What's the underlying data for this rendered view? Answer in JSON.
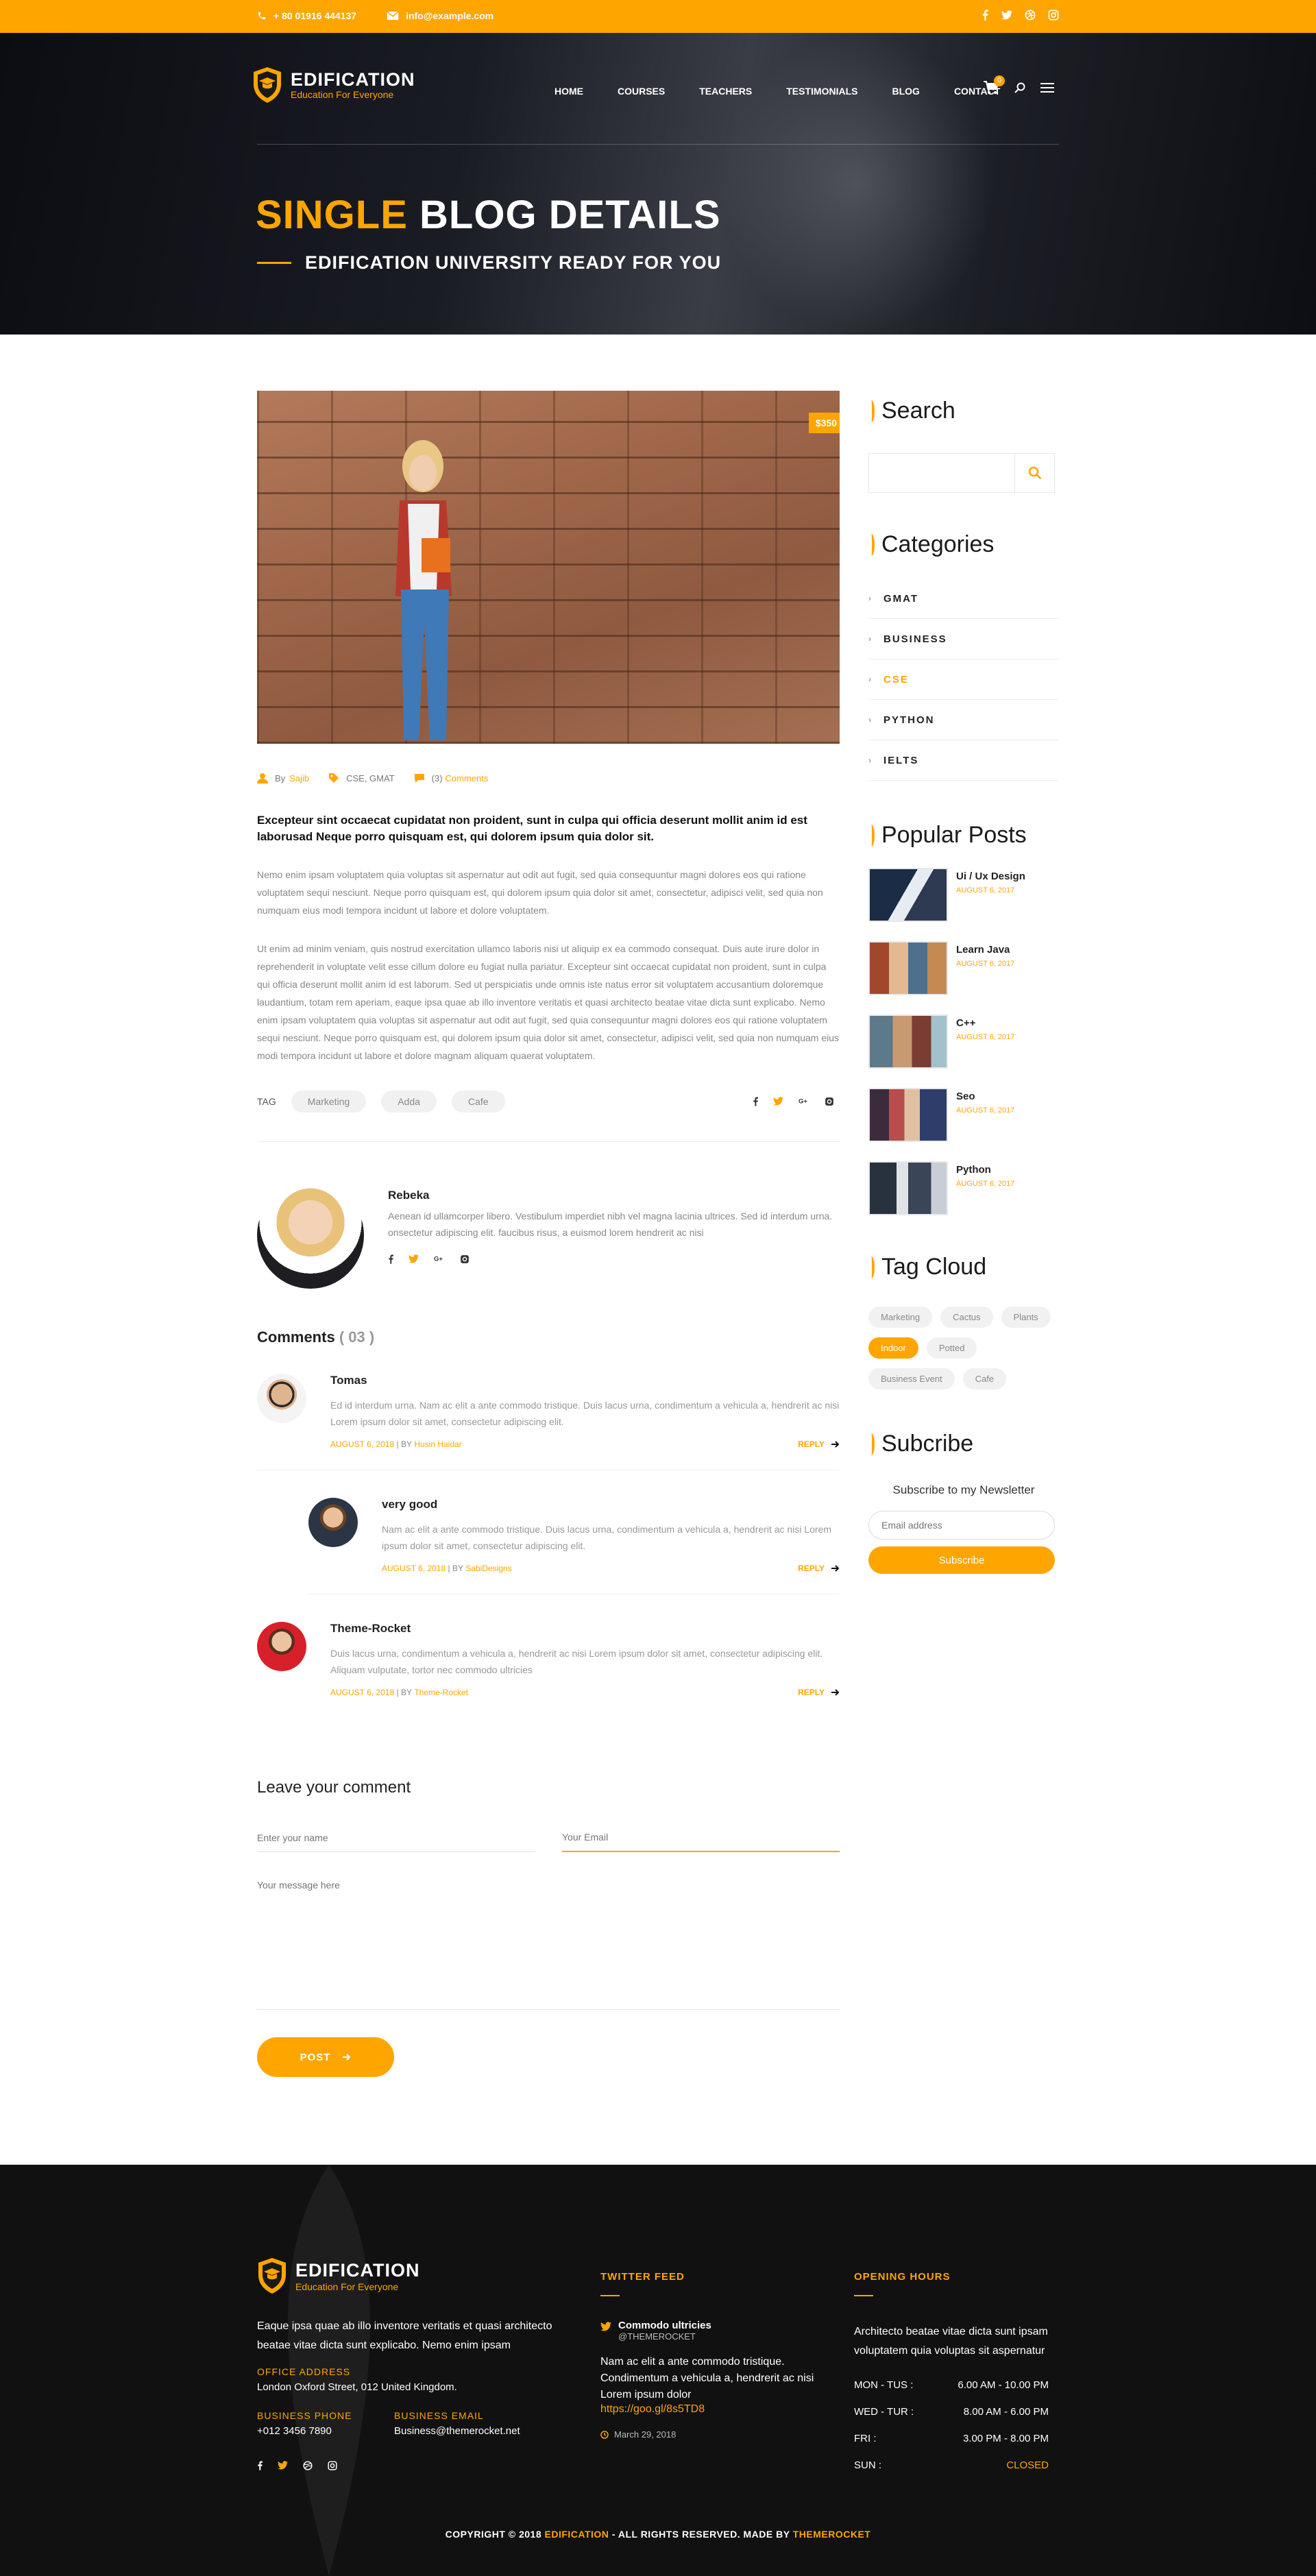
{
  "topbar": {
    "phone": "+ 80 01916 444137",
    "email": "info@example.com",
    "social": [
      "facebook-icon",
      "twitter-icon",
      "dribbble-icon",
      "instagram-icon"
    ]
  },
  "brand": {
    "name": "EDIFICATION",
    "tagline": "Education For Everyone"
  },
  "nav": {
    "items": [
      "HOME",
      "COURSES",
      "TEACHERS",
      "TESTIMONIALS",
      "BLOG",
      "CONTACT"
    ],
    "cart_count": "0"
  },
  "hero": {
    "title_highlight": "SINGLE",
    "title_rest": "BLOG DETAILS",
    "subtitle": "EDIFICATION UNIVERSITY READY FOR YOU"
  },
  "post": {
    "price": "$350",
    "author_prefix": "By",
    "author": "Sajib",
    "tags": "CSE, GMAT",
    "comment_count": "(3)",
    "comment_word": "Comments",
    "lead": "Excepteur sint occaecat cupidatat non proident, sunt in culpa qui officia deserunt mollit anim id est laborusad Neque porro quisquam est, qui dolorem ipsum quia dolor sit.",
    "para1": "Nemo enim ipsam voluptatem quia voluptas sit aspernatur aut odit aut fugit, sed quia consequuntur magni dolores eos qui ratione voluptatem sequi nesciunt. Neque porro quisquam est, qui dolorem ipsum quia dolor sit amet, consectetur, adipisci velit, sed quia non numquam eius modi tempora incidunt ut labore et dolore voluptatem.",
    "para2": "Ut enim ad minim veniam, quis nostrud exercitation ullamco laboris nisi ut aliquip ex ea commodo consequat. Duis aute irure dolor in reprehenderit in voluptate velit esse cillum dolore eu fugiat nulla pariatur. Excepteur sint occaecat cupidatat non proident, sunt in culpa qui officia deserunt mollit anim id est laborum. Sed ut perspiciatis unde omnis iste natus error sit voluptatem accusantium doloremque laudantium, totam rem aperiam, eaque ipsa quae ab illo inventore veritatis et quasi architecto beatae vitae dicta sunt explicabo. Nemo enim ipsam voluptatem quia voluptas sit aspernatur aut odit aut fugit, sed quia consequuntur magni dolores eos qui ratione voluptatem sequi nesciunt. Neque porro quisquam est, qui dolorem ipsum quia dolor sit amet, consectetur, adipisci velit, sed quia non numquam eius modi tempora incidunt ut labore et dolore magnam aliquam quaerat voluptatem.",
    "tag_label": "TAG",
    "tag_pills": [
      "Marketing",
      "Adda",
      "Cafe"
    ]
  },
  "author_box": {
    "name": "Rebeka",
    "bio": "Aenean id ullamcorper libero. Vestibulum imperdiet nibh vel magna lacinia ultrices. Sed id interdum urna. onsectetur adipiscing elit. faucibus risus, a euismod lorem hendrerit ac nisi"
  },
  "comments": {
    "heading": "Comments",
    "count": "( 03 )",
    "items": [
      {
        "name": "Tomas",
        "text": "Ed id interdum urna. Nam ac elit a ante commodo tristique. Duis lacus urna, condimentum a vehicula a, hendrerit ac nisi Lorem ipsum dolor sit amet, consectetur adipiscing elit.",
        "date": "AUGUST 6, 2018",
        "by": "BY",
        "author": "Husin Haidar",
        "reply": "REPLY"
      },
      {
        "name": "very good",
        "text": "Nam ac elit a ante commodo tristique. Duis lacus urna, condimentum a vehicula a, hendrerit ac nisi Lorem ipsum dolor sit amet, consectetur adipiscing elit.",
        "date": "AUGUST 6, 2018",
        "by": "BY",
        "author": "SabiDesigns",
        "reply": "REPLY"
      },
      {
        "name": "Theme-Rocket",
        "text": "Duis lacus urna, condimentum a vehicula a, hendrerit ac nisi Lorem ipsum dolor sit amet, consectetur adipiscing elit. Aliquam vulputate, tortor nec commodo ultricies",
        "date": "AUGUST 6, 2018",
        "by": "BY",
        "author": "Theme-Rocket",
        "reply": "REPLY"
      }
    ]
  },
  "form": {
    "heading": "Leave your comment",
    "name_placeholder": "Enter your name",
    "email_placeholder": "Your Email",
    "message_placeholder": "Your message here",
    "post_label": "POST"
  },
  "sidebar": {
    "search_title": "Search",
    "categories_title": "Categories",
    "categories": [
      "GMAT",
      "BUSINESS",
      "CSE",
      "PYTHON",
      "IELTS"
    ],
    "popular_title": "Popular Posts",
    "popular": [
      {
        "title": "Ui / Ux Design",
        "date": "AUGUST 6, 2017"
      },
      {
        "title": "Learn Java",
        "date": "AUGUST 6, 2017"
      },
      {
        "title": "C++",
        "date": "AUGUST 6, 2017"
      },
      {
        "title": "Seo",
        "date": "AUGUST 6, 2017"
      },
      {
        "title": "Python",
        "date": "AUGUST 6, 2017"
      }
    ],
    "tagcloud_title": "Tag Cloud",
    "tagcloud": [
      "Marketing",
      "Cactus",
      "Plants",
      "Indoor",
      "Potted",
      "Business Event",
      "Cafe"
    ],
    "subscribe_title": "Subcribe",
    "subscribe_text": "Subscribe to my Newsletter",
    "subscribe_placeholder": "Email address",
    "subscribe_button": "Subscribe"
  },
  "footer": {
    "about": "Eaque ipsa quae ab illo inventore veritatis et quasi architecto beatae vitae dicta sunt explicabo. Nemo enim ipsam",
    "office_label": "OFFICE ADDRESS",
    "office": "London Oxford Street, 012 United Kingdom.",
    "phone_label": "BUSINESS PHONE",
    "phone": "+012 3456 7890",
    "email_label": "BUSINESS EMAIL",
    "email": "Business@themerocket.net",
    "twitter_title": "TWITTER FEED",
    "tweet_name": "Commodo ultricies",
    "tweet_handle": "@THEMEROCKET",
    "tweet_text": "Nam ac elit a ante commodo tristique. Condimentum a vehicula a, hendrerit ac nisi Lorem ipsum dolor",
    "tweet_link": "https://goo.gl/8s5TD8",
    "tweet_date": "March 29, 2018",
    "hours_title": "OPENING HOURS",
    "hours_text": "Architecto beatae vitae dicta sunt ipsam voluptatem quia voluptas sit aspernatur",
    "hours": [
      {
        "day": "MON - TUS :",
        "time": "6.00 AM - 10.00 PM"
      },
      {
        "day": "WED - TUR :",
        "time": "8.00 AM - 6.00 PM"
      },
      {
        "day": "FRI :",
        "time": "3.00 PM - 8.00 PM"
      },
      {
        "day": "SUN :",
        "time": "CLOSED"
      }
    ],
    "copyright_prefix": "COPYRIGHT © 2018",
    "copyright_brand": "EDIFICATION",
    "copyright_mid": "- ALL RIGHTS RESERVED. MADE BY",
    "copyright_maker": "THEMEROCKET"
  },
  "colors": {
    "accent": "#ffa500",
    "dark": "#111111",
    "text_muted": "#888888"
  }
}
